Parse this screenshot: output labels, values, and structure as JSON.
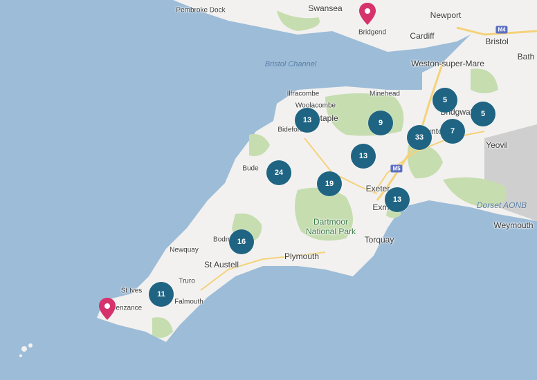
{
  "map": {
    "places": {
      "pembroke_dock": "Pembroke\nDock",
      "swansea": "Swansea",
      "bridgend": "Bridgend",
      "newport": "Newport",
      "cardiff": "Cardiff",
      "bristol": "Bristol",
      "bath": "Bath",
      "weston": "Weston-super-Mare",
      "bristol_channel": "Bristol Channel",
      "ilfracombe": "Ilfracombe",
      "woolacombe": "Woolacombe",
      "barnstaple": "Barnstaple",
      "minehead": "Minehead",
      "bridgwater": "Bridgwater",
      "bideford": "Bideford",
      "taunton": "Taunton",
      "yeovil": "Yeovil",
      "bude": "Bude",
      "exeter": "Exeter",
      "exmouth": "Exmouth",
      "dorset_aonb": "Dorset AONB",
      "weymouth": "Weymouth",
      "dartmoor": "Dartmoor\nNational Park",
      "torquay": "Torquay",
      "newquay": "Newquay",
      "bodmin": "Bodmin",
      "st_austell": "St Austell",
      "plymouth": "Plymouth",
      "truro": "Truro",
      "st_ives": "St Ives",
      "penzance": "Penzance",
      "falmouth": "Falmouth"
    },
    "roads": {
      "m5": "M5",
      "m4": "M4"
    },
    "clusters": [
      "5",
      "5",
      "9",
      "13",
      "7",
      "33",
      "24",
      "13",
      "19",
      "13",
      "16",
      "11"
    ],
    "pins": [
      "location-pin",
      "location-pin"
    ],
    "colors": {
      "sea": "#9dbcd8",
      "land": "#f2f1ef",
      "park": "#c6ddb0",
      "cluster": "#1f6483",
      "pin": "#d6336c",
      "road": "#f5d27a"
    }
  }
}
